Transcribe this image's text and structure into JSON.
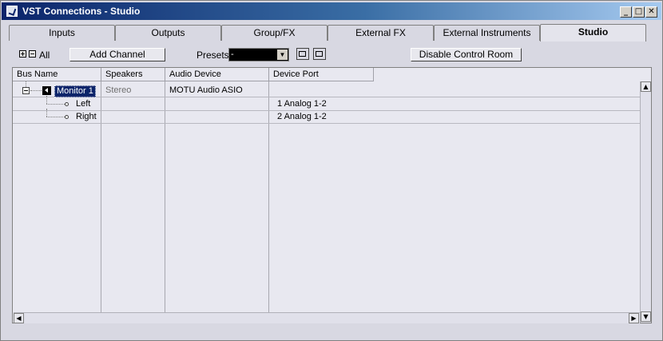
{
  "window": {
    "title": "VST Connections - Studio"
  },
  "tabs": [
    {
      "label": "Inputs",
      "active": false
    },
    {
      "label": "Outputs",
      "active": false
    },
    {
      "label": "Group/FX",
      "active": false
    },
    {
      "label": "External FX",
      "active": false
    },
    {
      "label": "External Instruments",
      "active": false
    },
    {
      "label": "Studio",
      "active": true
    }
  ],
  "toolbar": {
    "all_label": "All",
    "add_channel_label": "Add Channel",
    "presets_label": "Presets",
    "presets_value": "-",
    "disable_control_room_label": "Disable Control Room"
  },
  "table": {
    "columns": [
      "Bus Name",
      "Speakers",
      "Audio Device",
      "Device Port"
    ],
    "rows": [
      {
        "bus_name": "Monitor 1",
        "speakers": "Stereo",
        "audio_device": "MOTU Audio ASIO",
        "device_port": ""
      },
      {
        "bus_name": "Left",
        "speakers": "",
        "audio_device": "",
        "device_port": "1 Analog 1-2"
      },
      {
        "bus_name": "Right",
        "speakers": "",
        "audio_device": "",
        "device_port": "2 Analog 1-2"
      }
    ]
  },
  "icons": {
    "app": "app-icon",
    "speaker": "speaker-icon",
    "minimize": "minimize-icon",
    "maximize": "maximize-icon",
    "close": "close-icon"
  },
  "colors": {
    "title_start": "#0a246a",
    "title_end": "#a6caf0",
    "selection": "#0a246a",
    "background": "#d8d8e2"
  }
}
